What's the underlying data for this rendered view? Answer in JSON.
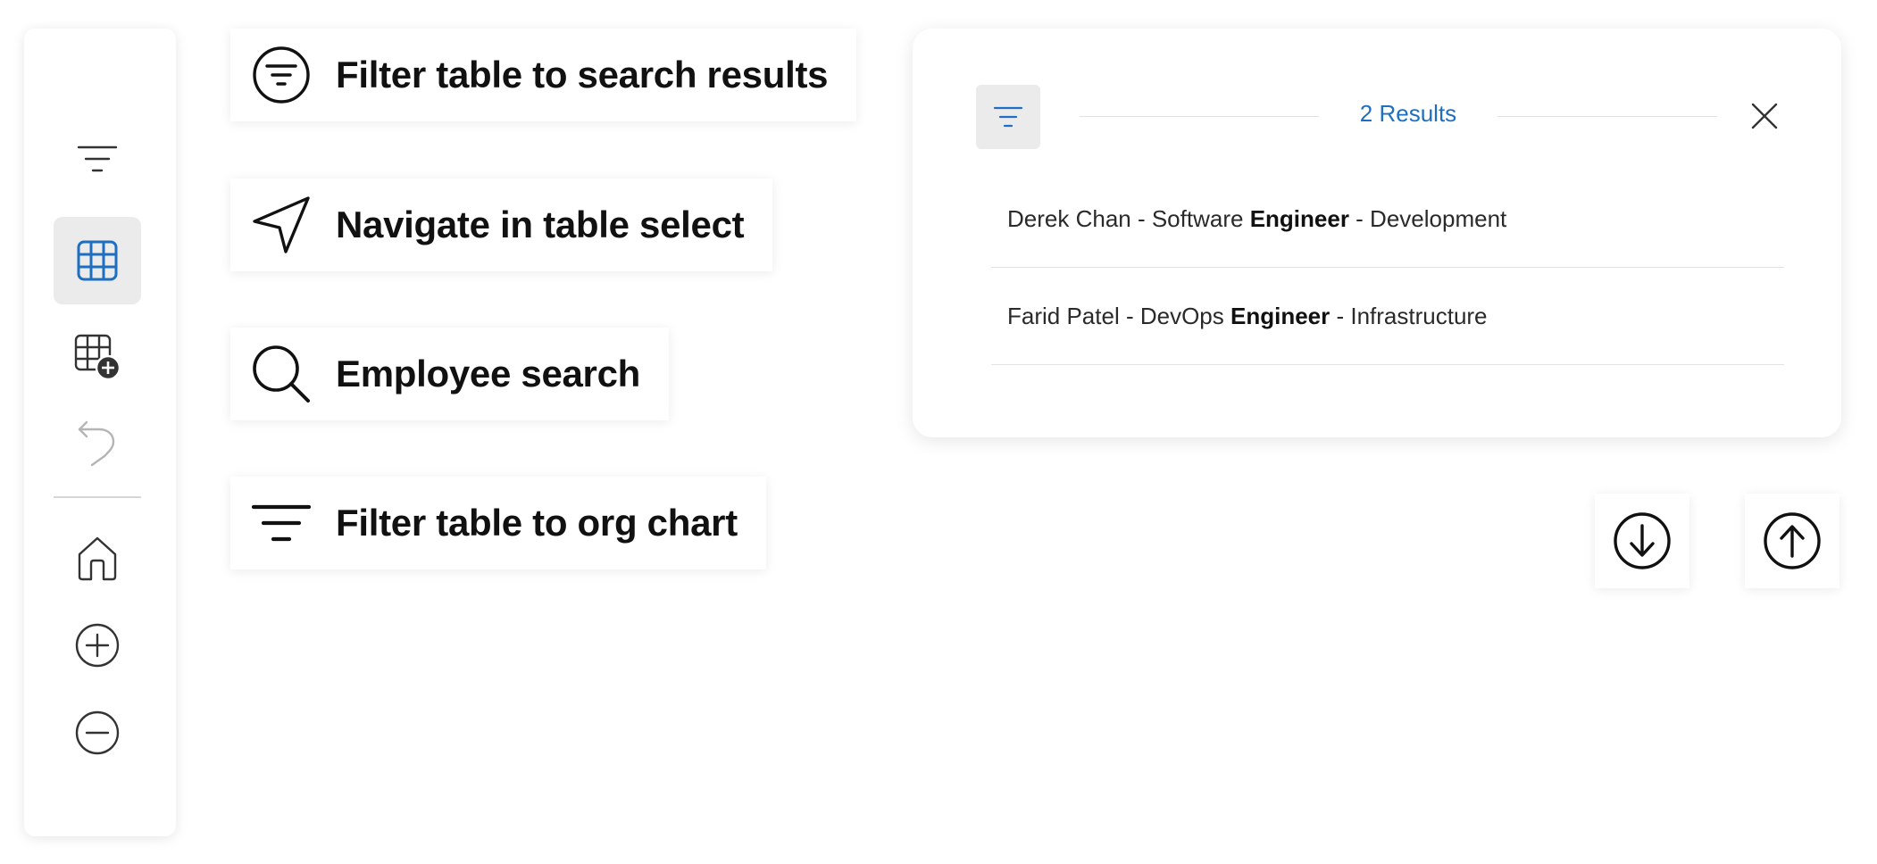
{
  "toolbar": {
    "items": [
      {
        "icon": "filter-lines-icon",
        "active": false
      },
      {
        "icon": "table-icon",
        "active": true
      },
      {
        "icon": "table-add-icon",
        "active": false
      },
      {
        "icon": "undo-icon",
        "active": false,
        "disabled": true
      },
      {
        "icon": "home-icon",
        "active": false
      },
      {
        "icon": "zoom-in-icon",
        "active": false
      },
      {
        "icon": "zoom-out-icon",
        "active": false
      }
    ]
  },
  "legend": {
    "items": [
      {
        "icon": "filter-circle-icon",
        "label": "Filter table to search results"
      },
      {
        "icon": "navigate-icon",
        "label": "Navigate in table select"
      },
      {
        "icon": "search-icon",
        "label": "Employee search"
      },
      {
        "icon": "filter-lines-icon",
        "label": "Filter table to org chart"
      }
    ]
  },
  "results": {
    "count_label": "2 Results",
    "rows": [
      {
        "name_part": "Derek Chan - Software ",
        "match": "Engineer",
        "rest": " - Development"
      },
      {
        "name_part": "Farid Patel - DevOps ",
        "match": "Engineer",
        "rest": " - Infrastructure"
      }
    ]
  },
  "scroll": {
    "down_icon": "arrow-down-circle-icon",
    "up_icon": "arrow-up-circle-icon"
  },
  "colors": {
    "accent": "#1e6fc2",
    "active_bg": "#ebebeb",
    "disabled_icon": "#b5b5b5"
  }
}
